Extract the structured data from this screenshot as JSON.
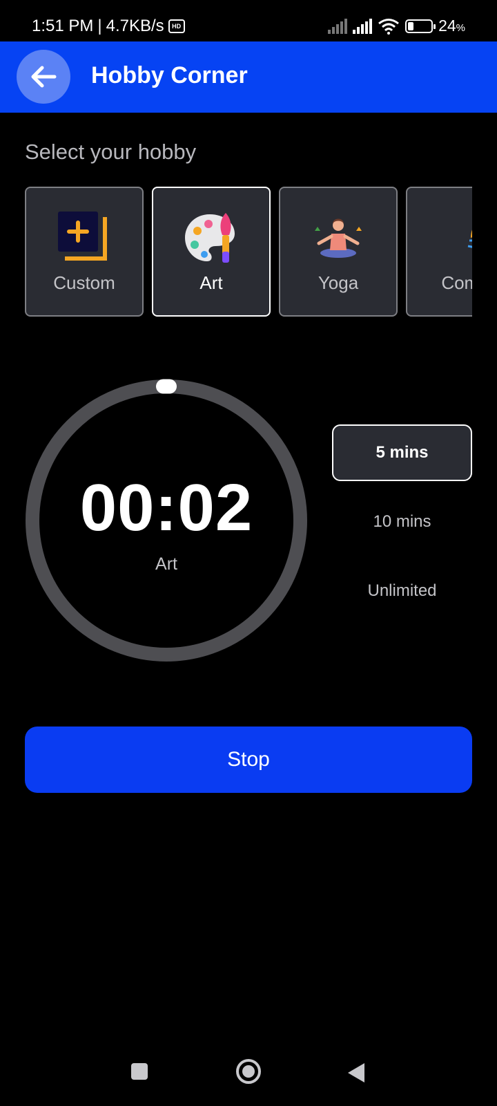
{
  "status_bar": {
    "time": "1:51 PM",
    "separator": "|",
    "net_speed": "4.7KB/s",
    "hd_badge": "HD",
    "battery_percent": "24",
    "battery_unit": "%",
    "battery_level": 0.24
  },
  "app_bar": {
    "title": "Hobby Corner",
    "back_icon": "arrow-left-icon",
    "background_color": "#0643f3"
  },
  "hobby_section": {
    "label": "Select your hobby",
    "hobbies": [
      {
        "label": "Custom",
        "icon": "custom-plus-icon",
        "selected": false
      },
      {
        "label": "Art",
        "icon": "palette-icon",
        "selected": true
      },
      {
        "label": "Yoga",
        "icon": "yoga-icon",
        "selected": false
      },
      {
        "label": "Comp",
        "icon": "computer-person-icon",
        "selected": false
      }
    ]
  },
  "timer": {
    "time": "00:02",
    "hobby": "Art",
    "progress": 0.0,
    "ring_color": "#4e4e52"
  },
  "durations": [
    {
      "label": "5 mins",
      "selected": true
    },
    {
      "label": "10 mins",
      "selected": false
    },
    {
      "label": "Unlimited",
      "selected": false
    }
  ],
  "stop_button": {
    "label": "Stop",
    "color": "#0a3cf2"
  },
  "nav_bar": {
    "items": [
      "recents-icon",
      "home-icon",
      "back-icon"
    ]
  }
}
